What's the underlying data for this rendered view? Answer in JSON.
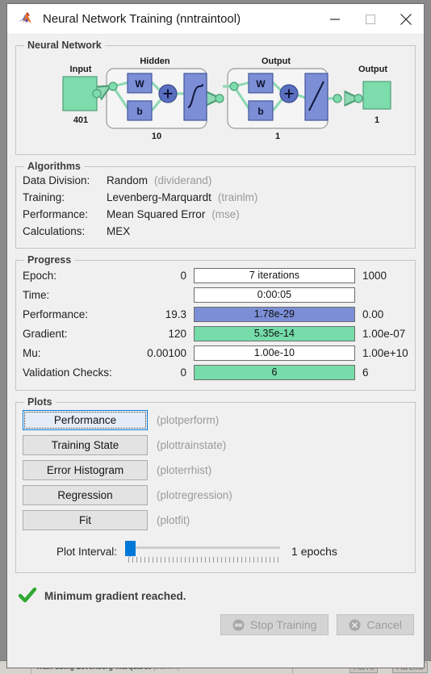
{
  "window": {
    "title": "Neural Network Training (nntraintool)",
    "app_icon": "matlab-membrane-icon",
    "controls": {
      "minimize": "minimize-icon",
      "maximize": "maximize-icon",
      "close": "close-icon"
    }
  },
  "neural_network": {
    "legend": "Neural Network",
    "input": {
      "label": "Input",
      "size": "401"
    },
    "hidden": {
      "label": "Hidden",
      "size": "10",
      "weight": "W",
      "bias": "b",
      "transfer": "tansig-sigmoid-icon"
    },
    "output_layer": {
      "label": "Output",
      "size": "1",
      "weight": "W",
      "bias": "b",
      "transfer": "purelin-linear-icon"
    },
    "output": {
      "label": "Output",
      "size": "1"
    },
    "colors": {
      "block": "#7b8ed6",
      "node": "#7ddcac",
      "line": "#7ddcac"
    }
  },
  "algorithms": {
    "legend": "Algorithms",
    "rows": [
      {
        "label": "Data Division:",
        "value": "Random",
        "func": "(dividerand)"
      },
      {
        "label": "Training:",
        "value": "Levenberg-Marquardt",
        "func": "(trainlm)"
      },
      {
        "label": "Performance:",
        "value": "Mean Squared Error",
        "func": "(mse)"
      },
      {
        "label": "Calculations:",
        "value": "MEX",
        "func": ""
      }
    ]
  },
  "progress": {
    "legend": "Progress",
    "rows": [
      {
        "label": "Epoch:",
        "min": "0",
        "current": "7 iterations",
        "max": "1000",
        "bar_style": "none",
        "fill_percent": 0,
        "bold_prefix": "7"
      },
      {
        "label": "Time:",
        "min": "",
        "current": "0:00:05",
        "max": "",
        "bar_style": "none",
        "fill_percent": 0
      },
      {
        "label": "Performance:",
        "min": "19.3",
        "current": "1.78e-29",
        "max": "0.00",
        "bar_style": "blue",
        "fill_percent": 100
      },
      {
        "label": "Gradient:",
        "min": "120",
        "current": "5.35e-14",
        "max": "1.00e-07",
        "bar_style": "green",
        "fill_percent": 100
      },
      {
        "label": "Mu:",
        "min": "0.00100",
        "current": "1.00e-10",
        "max": "1.00e+10",
        "bar_style": "none",
        "fill_percent": 0
      },
      {
        "label": "Validation Checks:",
        "min": "0",
        "current": "6",
        "max": "6",
        "bar_style": "green",
        "fill_percent": 100
      }
    ],
    "colors": {
      "blue": "#7b8ed6",
      "green": "#75dcaa"
    }
  },
  "plots": {
    "legend": "Plots",
    "buttons": [
      {
        "label": "Performance",
        "func": "(plotperform)",
        "focused": true
      },
      {
        "label": "Training State",
        "func": "(plottrainstate)",
        "focused": false
      },
      {
        "label": "Error Histogram",
        "func": "(ploterrhist)",
        "focused": false
      },
      {
        "label": "Regression",
        "func": "(plotregression)",
        "focused": false
      },
      {
        "label": "Fit",
        "func": "(plotfit)",
        "focused": false
      }
    ],
    "interval": {
      "label": "Plot Interval:",
      "value": "1 epochs",
      "slider_position_percent": 0
    }
  },
  "status": {
    "icon": "green-check-icon",
    "message": "Minimum gradient reached."
  },
  "actions": [
    {
      "label": "Stop Training",
      "icon": "stop-sign-icon",
      "enabled": false
    },
    {
      "label": "Cancel",
      "icon": "cancel-circle-icon",
      "enabled": false
    }
  ],
  "background_window": {
    "checkbox_label": "Train using Levenberg-Marquardt",
    "checkbox_func": "(trainlm)",
    "buttons": [
      "Plot Fit",
      "Plot Error"
    ]
  }
}
